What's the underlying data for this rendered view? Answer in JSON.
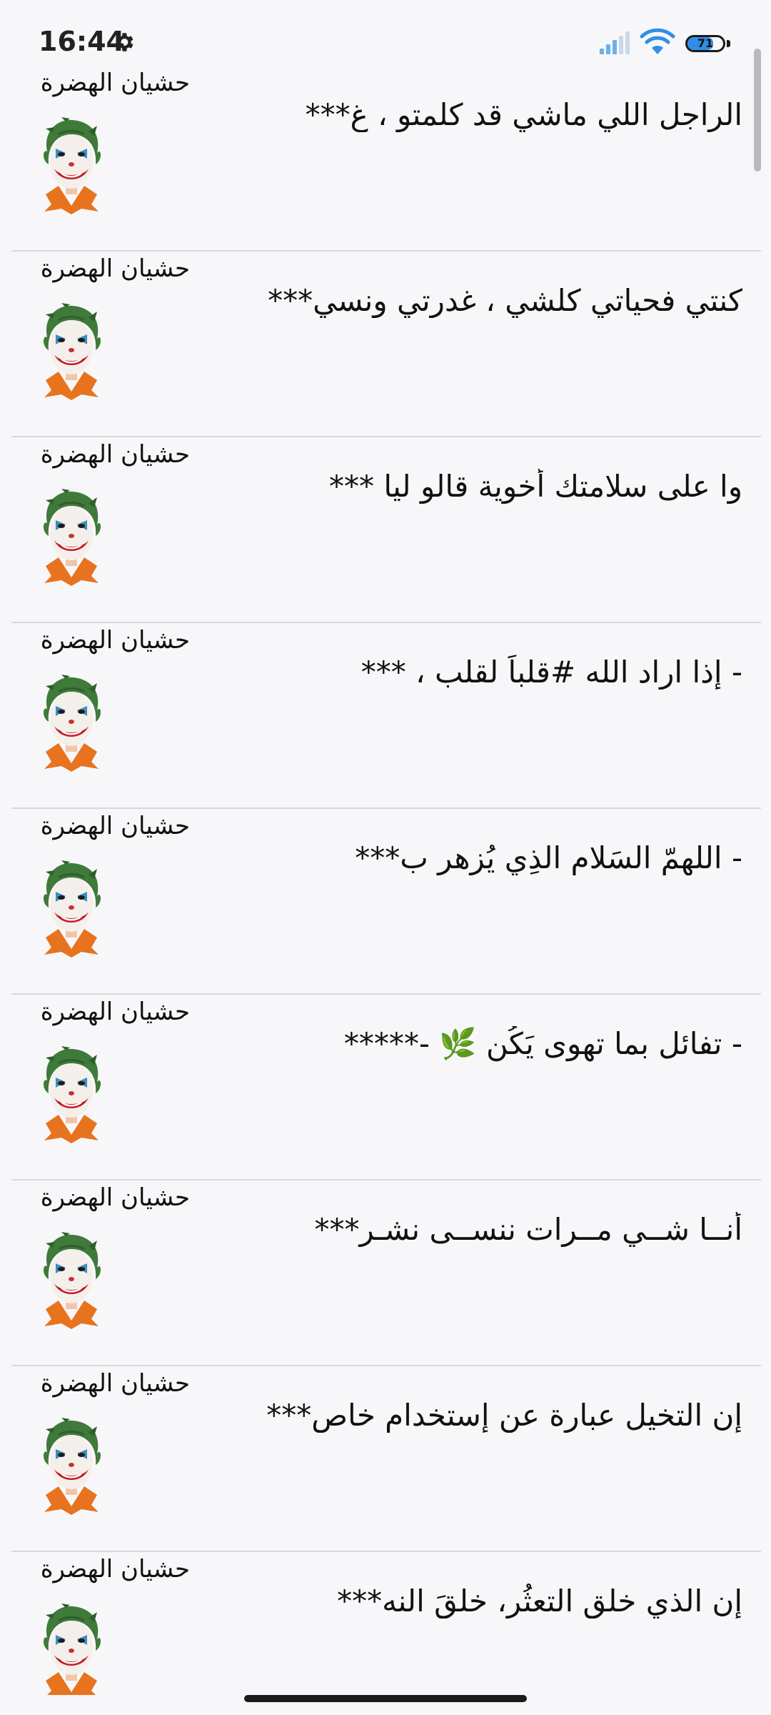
{
  "status_bar": {
    "time": "16:44",
    "battery_level": "71",
    "battery_fraction": 0.71,
    "icons": [
      "gear-icon",
      "signal-icon",
      "wifi-icon",
      "battery-icon"
    ],
    "colors": {
      "signal": "#6db0ea",
      "wifi": "#2f8fe6",
      "battery_fill": "#2f8fe6"
    }
  },
  "posts": [
    {
      "author": "حشيان الهضرة",
      "text": "الراجل اللي ماشي قد كلمتو ، غ***"
    },
    {
      "author": "حشيان الهضرة",
      "text": "كنتي فحياتي كلشي ، غدرتي ونسي***"
    },
    {
      "author": "حشيان الهضرة",
      "text": "وا على سلامتك أخوية قالو ليا ***"
    },
    {
      "author": "حشيان الهضرة",
      "text": "- إذا اراد الله #قلباً لقلب ، ***"
    },
    {
      "author": "حشيان الهضرة",
      "text": "- اللهمّ السَلام الذِي يُزهر ب***"
    },
    {
      "author": "حشيان الهضرة",
      "text": "- تفائل بما تهوى يَكُن 🌿 -*****"
    },
    {
      "author": "حشيان الهضرة",
      "text": "أنــا شــي مــرات ننســى نشـر***"
    },
    {
      "author": "حشيان الهضرة",
      "text": "إن التخيل عبارة عن إستخدام خاص***"
    },
    {
      "author": "حشيان الهضرة",
      "text": "إن الذي خلق التعثُر، خلقَ النه***"
    }
  ]
}
